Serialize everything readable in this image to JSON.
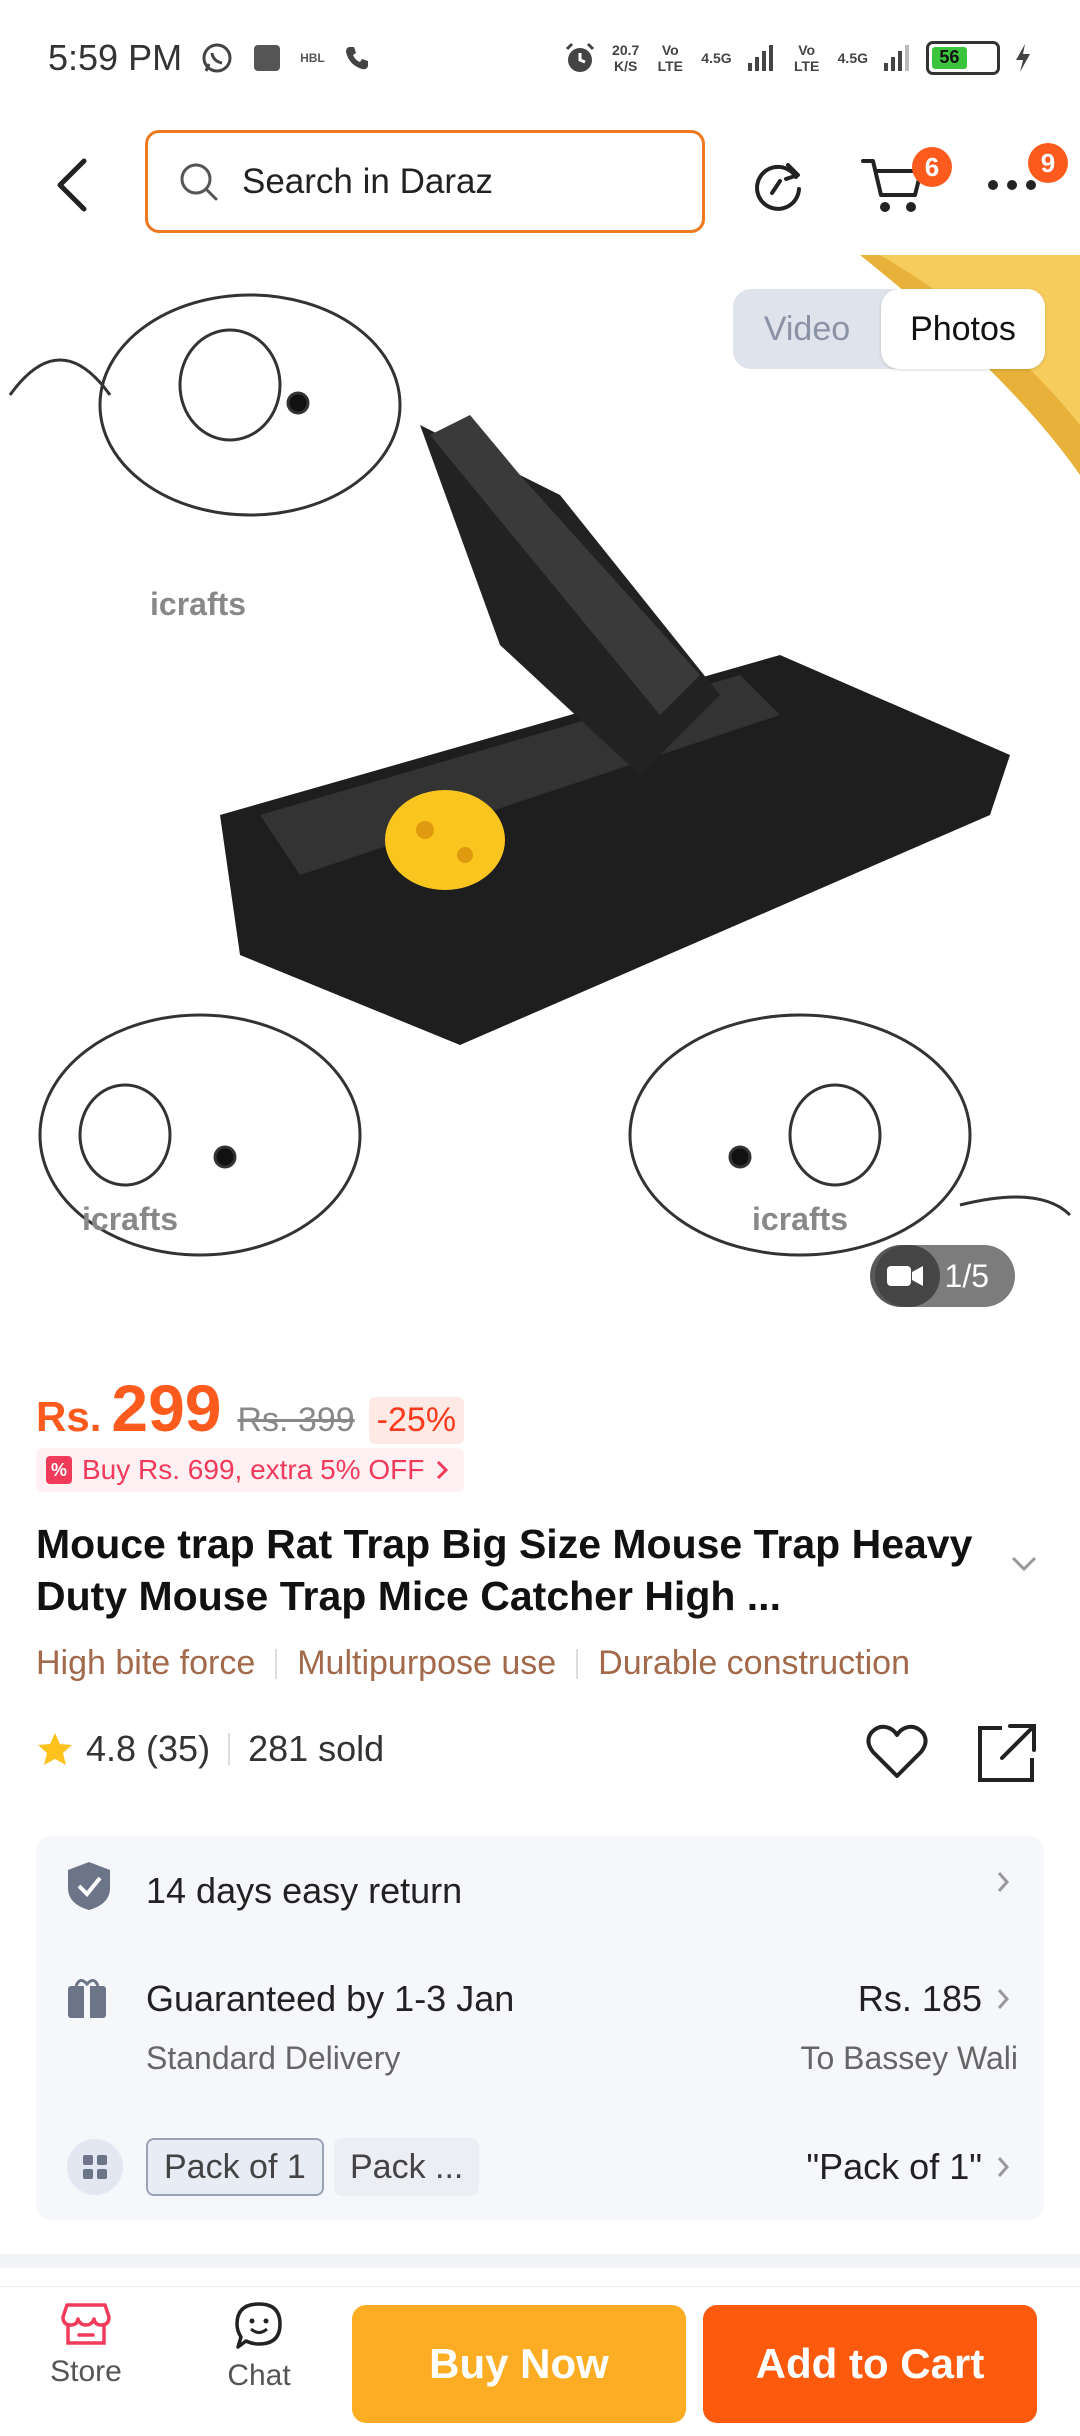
{
  "status_bar": {
    "time": "5:59 PM",
    "net_speed": "20.7",
    "net_speed_unit": "K/S",
    "sim1_label": "Vo LTE",
    "sim1_net": "4.5G",
    "sim2_label": "Vo LTE",
    "sim2_net": "4.5G",
    "battery": "56",
    "carrier_tag": "HBL"
  },
  "header": {
    "search_placeholder": "Search in Daraz",
    "cart_badge": "6",
    "more_badge": "9"
  },
  "gallery": {
    "toggle_video": "Video",
    "toggle_photos": "Photos",
    "counter": "1/5",
    "watermark": "icrafts"
  },
  "price": {
    "currency": "Rs.",
    "value": "299",
    "old": "Rs. 399",
    "discount": "-25%",
    "promo": "Buy Rs. 699, extra 5% OFF"
  },
  "product": {
    "title": "Mouce trap Rat Trap Big Size Mouse Trap Heavy Duty Mouse Trap Mice Catcher High ...",
    "features": [
      "High bite force",
      "Multipurpose use",
      "Durable construction"
    ],
    "rating": "4.8",
    "reviews": "(35)",
    "sold": "281 sold"
  },
  "info": {
    "return_text": "14 days easy return",
    "delivery_title": "Guaranteed by 1-3 Jan",
    "delivery_sub": "Standard Delivery",
    "delivery_price": "Rs. 185",
    "delivery_location": "To Bassey Wali",
    "pack_selected": "Pack of 1",
    "pack_other": "Pack ...",
    "pack_value": "\"Pack of 1\""
  },
  "bottom": {
    "store": "Store",
    "chat": "Chat",
    "buy_now": "Buy Now",
    "add_to_cart": "Add to Cart"
  },
  "colors": {
    "accent": "#fd5a1e",
    "buy_now": "#fdad24",
    "add_to_cart": "#fd5a0d",
    "feature_text": "#a2694a",
    "promo": "#f23a5b"
  }
}
